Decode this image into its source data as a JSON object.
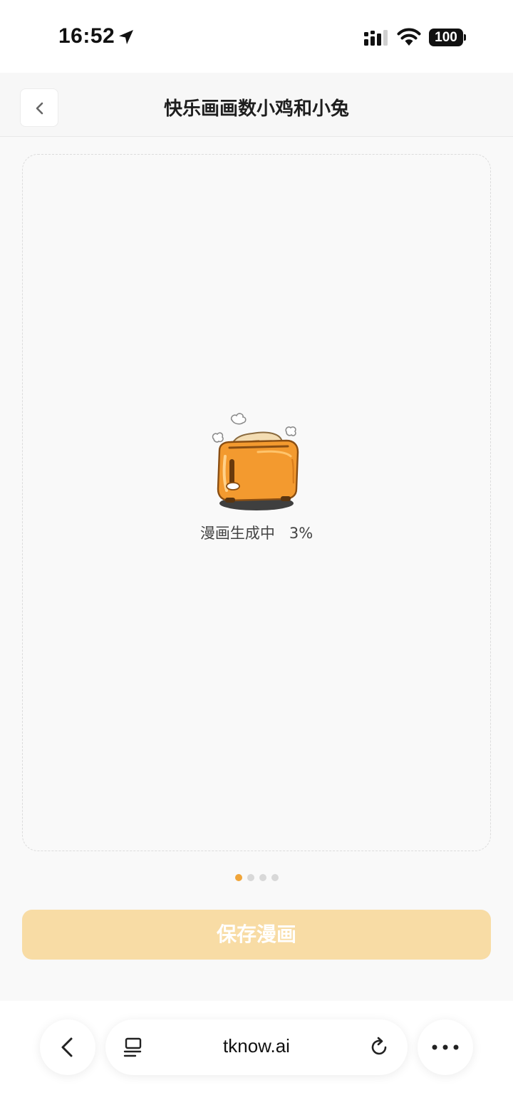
{
  "status_bar": {
    "time": "16:52",
    "battery": "100"
  },
  "header": {
    "title": "快乐画画数小鸡和小兔"
  },
  "canvas": {
    "loading_label": "漫画生成中",
    "progress_label": "3%",
    "progress": 0.03
  },
  "pager": {
    "count": 4,
    "active_index": 0
  },
  "actions": {
    "save_label": "保存漫画"
  },
  "browser": {
    "url": "tknow.ai"
  },
  "colors": {
    "accent": "#f0a53a",
    "save_button_bg": "#f8dca5",
    "toaster_orange": "#f39a2f"
  },
  "icons": {
    "location": "location-arrow-icon",
    "signal": "cellular-signal-icon",
    "wifi": "wifi-icon",
    "back": "chevron-left-icon",
    "reader": "reader-mode-icon",
    "reload": "reload-icon",
    "more": "more-dots-icon",
    "illustration": "toaster-icon"
  }
}
